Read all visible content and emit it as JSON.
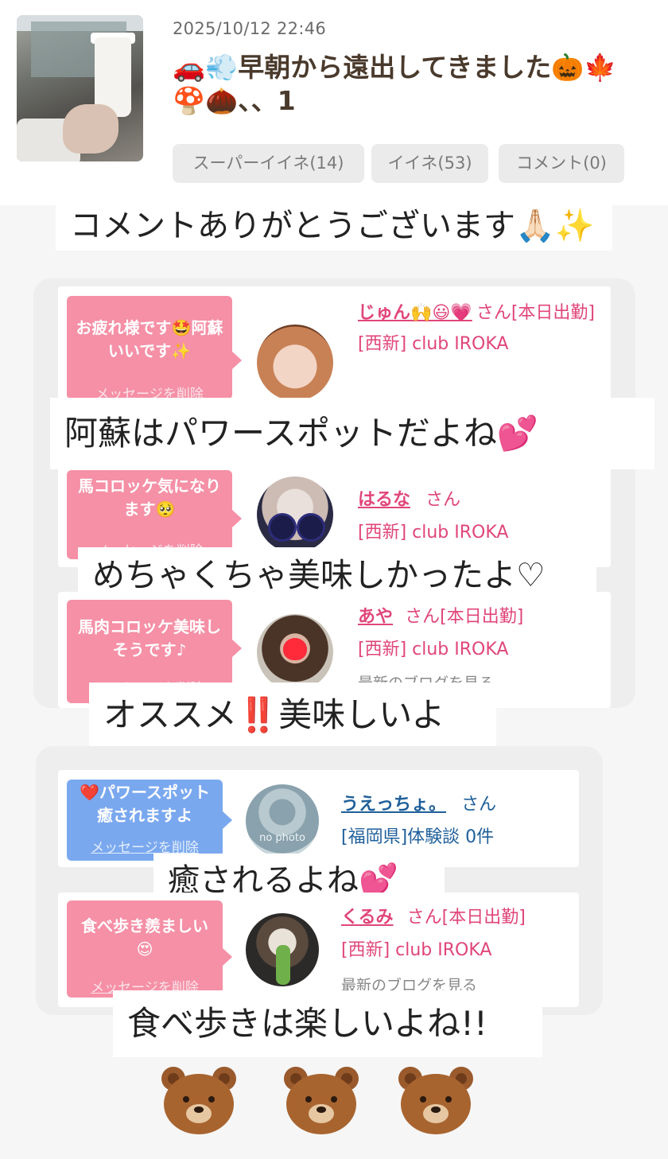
{
  "post": {
    "date": "2025/10/12 22:46",
    "title_emoji_start": "🚗💨",
    "title_text": "早朝から遠出してきました",
    "title_emoji_end": "🎃🍁",
    "title_line2_emoji": "🍄🌰",
    "title_line2_text": "、、1",
    "buttons": {
      "super_like": "スーパーイイネ(14)",
      "like": "イイネ(53)",
      "comment": "コメント(0)"
    }
  },
  "captions": {
    "thanks": "コメントありがとうございます🙏🏻✨",
    "aso": "阿蘇はパワースポットだよね💕",
    "delicious": "めちゃくちゃ美味しかったよ♡",
    "recommend": "オススメ‼️美味しいよ",
    "healing": "癒されるよね💕",
    "walking": "食べ歩きは楽しいよね!!"
  },
  "comments": [
    {
      "message": "お疲れ様です🤩阿蘇いいです✨",
      "delete": "メッセージを削除",
      "name": "じゅん🙌😃💗",
      "san": "さん[本日出勤]",
      "shop": "[西新] club IROKA"
    },
    {
      "message": "馬コロッケ気になります🥺",
      "delete": "メッセージを削除",
      "name": "はるな",
      "san": "さん",
      "shop": "[西新] club IROKA"
    },
    {
      "message": "馬肉コロッケ美味しそうです♪",
      "delete": "メッセージを削除",
      "name": "あや",
      "san": "さん[本日出勤]",
      "shop": "[西新] club IROKA",
      "latest": "最新のブログを見る"
    },
    {
      "message": "❤️パワースポット癒されますよ",
      "delete": "メッセージを削除",
      "name": "うえっちょ。",
      "san": "さん",
      "shop": "[福岡県]体験談 0件",
      "avatar_text": "no photo"
    },
    {
      "message": "食べ歩き羨ましい😍",
      "delete": "メッセージを削除",
      "name": "くるみ",
      "san": "さん[本日出勤]",
      "shop": "[西新] club IROKA",
      "latest": "最新のブログを見る"
    }
  ],
  "colors": {
    "pink_bubble": "#f590a6",
    "blue_bubble": "#7aa8ef",
    "pink_text": "#e0467a",
    "blue_text": "#1f5f9a",
    "title_brown": "#4a3a2c"
  },
  "icons": [
    "bear-sticker",
    "bear-sticker",
    "bear-sticker"
  ]
}
